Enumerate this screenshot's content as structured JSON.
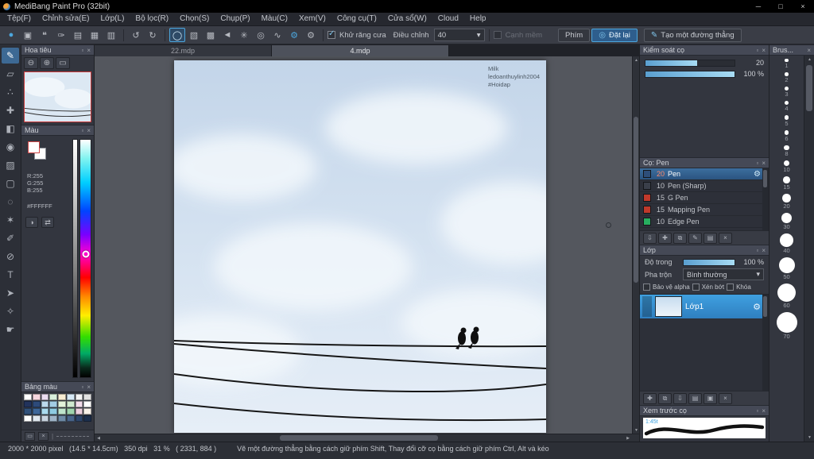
{
  "titlebar": {
    "title": "MediBang Paint Pro (32bit)",
    "minimize": "─",
    "maximize": "□",
    "close": "×"
  },
  "menubar": {
    "items": [
      "Tệp(F)",
      "Chỉnh sửa(E)",
      "Lớp(L)",
      "Bộ lọc(R)",
      "Chọn(S)",
      "Chụp(P)",
      "Màu(C)",
      "Xem(V)",
      "Công cụ(T)",
      "Cửa sổ(W)",
      "Cloud",
      "Help"
    ]
  },
  "toolbar": {
    "groups": [
      [
        {
          "name": "app-brush",
          "glyph": "●",
          "accent": true
        },
        {
          "name": "save",
          "glyph": "▣"
        },
        {
          "name": "comment",
          "glyph": "❝"
        },
        {
          "name": "brush-case",
          "glyph": "✑"
        },
        {
          "name": "document",
          "glyph": "▤"
        },
        {
          "name": "material-grid",
          "glyph": "▦"
        },
        {
          "name": "cell-grid",
          "glyph": "▥"
        }
      ],
      [
        {
          "name": "undo",
          "glyph": "↺"
        },
        {
          "name": "redo",
          "glyph": "↻"
        }
      ],
      [
        {
          "name": "shape-circle",
          "glyph": "◯",
          "selected": true
        },
        {
          "name": "gradient",
          "glyph": "▧"
        },
        {
          "name": "hatch",
          "glyph": "▩"
        },
        {
          "name": "angle-left",
          "glyph": "◄"
        },
        {
          "name": "snap",
          "glyph": "✳"
        },
        {
          "name": "target",
          "glyph": "◎"
        },
        {
          "name": "curve",
          "glyph": "∿"
        },
        {
          "name": "settings-primary",
          "glyph": "⚙",
          "accent": true
        },
        {
          "name": "settings",
          "glyph": "⚙"
        }
      ]
    ],
    "antialias_label": "Khử răng cưa",
    "adjust_label": "Điều chỉnh",
    "adjust_value": "40",
    "soft_edge_label": "Cạnh mềm",
    "key_label": "Phím",
    "reset_label": "Đặt lại",
    "line_label": "Tạo một đường thẳng"
  },
  "toolstrip": {
    "tools": [
      {
        "name": "brush",
        "glyph": "✎",
        "selected": true
      },
      {
        "name": "eraser",
        "glyph": "▱"
      },
      {
        "name": "dot",
        "glyph": "∴"
      },
      {
        "name": "move",
        "glyph": "✚"
      },
      {
        "name": "fill",
        "glyph": "◧"
      },
      {
        "name": "bucket",
        "glyph": "◉"
      },
      {
        "name": "gradient",
        "glyph": "▨"
      },
      {
        "name": "select",
        "glyph": "▢"
      },
      {
        "name": "lasso",
        "glyph": "◌"
      },
      {
        "name": "magic-wand",
        "glyph": "✶"
      },
      {
        "name": "select-pen",
        "glyph": "✐"
      },
      {
        "name": "select-eraser",
        "glyph": "⊘"
      },
      {
        "name": "text",
        "glyph": "T"
      },
      {
        "name": "operation",
        "glyph": "➤"
      },
      {
        "name": "eyedropper",
        "glyph": "✧"
      },
      {
        "name": "hand",
        "glyph": "☛"
      }
    ]
  },
  "tabs": {
    "items": [
      {
        "label": "22.mdp"
      },
      {
        "label": "4.mdp"
      }
    ]
  },
  "canvas": {
    "watermark_lines": [
      "Milk",
      "ledoanthuylinh2004",
      "#Hoidap"
    ]
  },
  "left_panels": {
    "navigator": {
      "title": "Hoa tiêu"
    },
    "color": {
      "title": "Màu",
      "r": "R:255",
      "g": "G:255",
      "b": "B:255",
      "hex": "#FFFFFF"
    },
    "palette": {
      "title": "Bảng màu",
      "swatches": [
        "#ffffff",
        "#f6d7de",
        "#eadcf0",
        "#d9efdb",
        "#f7ecd2",
        "#d6e8f5",
        "#f3f3f3",
        "#e2e2e2",
        "#22335c",
        "#2d4a7a",
        "#bcd9ec",
        "#a2cce4",
        "#e2f2da",
        "#cfe9cf",
        "#f2dcea",
        "#ffffff",
        "#31517a",
        "#3d6699",
        "#aadaee",
        "#8ecbe2",
        "#bfe4cc",
        "#a0d4ae",
        "#ecd0de",
        "#f8f1e9",
        "#ffffff",
        "#dfe7ef",
        "#c8d3df",
        "#9fb4c8",
        "#6e8aa6",
        "#49658a",
        "#2e466b",
        "#1d2f4d"
      ]
    }
  },
  "right_panels": {
    "brush_control": {
      "title": "Kiểm soát cọ",
      "size_value": "20",
      "opacity_value": "100 %"
    },
    "brush_list": {
      "title": "Cọ: Pen",
      "items": [
        {
          "size": "20",
          "name": "Pen",
          "chip": "#2e4e79",
          "selected": true
        },
        {
          "size": "10",
          "name": "Pen (Sharp)",
          "chip": "#3a3f4a"
        },
        {
          "size": "15",
          "name": "G Pen",
          "chip": "#c0392b"
        },
        {
          "size": "15",
          "name": "Mapping Pen",
          "chip": "#c0392b"
        },
        {
          "size": "10",
          "name": "Edge Pen",
          "chip": "#27ae60"
        }
      ]
    },
    "layer": {
      "title": "Lớp",
      "opacity_label": "Độ trong",
      "opacity_value": "100 %",
      "blend_label": "Pha trộn",
      "blend_value": "Bình thường",
      "alpha_label": "Bảo vệ alpha",
      "clip_label": "Xén bớt",
      "lock_label": "Khóa",
      "layers": [
        {
          "name": "Lớp1"
        }
      ]
    },
    "brush_preview": {
      "title": "Xem trước cọ",
      "scale_label": "1:45t"
    },
    "brushes_strip": {
      "title": "Brus...",
      "sizes": [
        1,
        2,
        3,
        4,
        5,
        6,
        8,
        10,
        15,
        20,
        30,
        40,
        50,
        60,
        70
      ]
    }
  },
  "statusbar": {
    "info": "2000 * 2000 pixel   (14.5 * 14.5cm)   350 dpi   31 %   ( 2331, 884 )",
    "hint": "Vẽ một đường thẳng bằng cách giữ phím Shift, Thay đổi cỡ cọ bằng cách giữ phím Ctrl, Alt và kéo"
  }
}
